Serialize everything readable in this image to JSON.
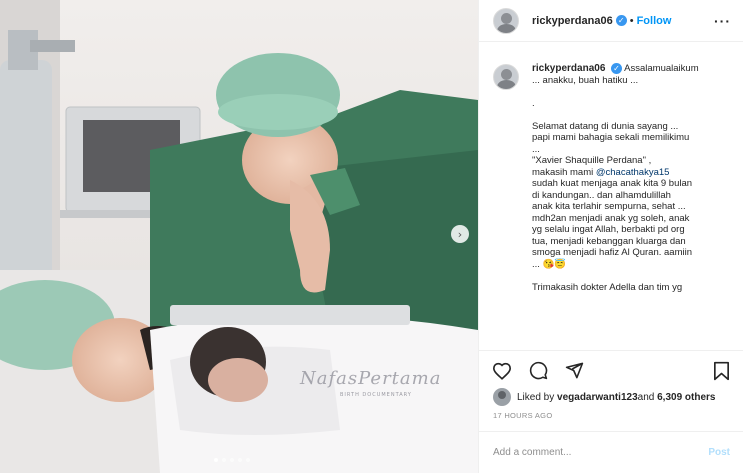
{
  "post": {
    "username": "rickyperdana06",
    "separator": "•",
    "follow_label": "Follow",
    "more_icon": "more-options-icon",
    "more_label": "···"
  },
  "media": {
    "next_icon": "chevron-right-icon",
    "next_label": "›",
    "watermark": "NafasPertama",
    "watermark_sub": "BIRTH DOCUMENTARY",
    "carousel_total": 5,
    "carousel_active": 1
  },
  "caption": {
    "username": "rickyperdana06",
    "text_before_mention": "Assalamualaikum\n... anakku, buah hatiku ...\n\n.\n\nSelamat datang di dunia sayang ...\npapi mami bahagia sekali memilikimu\n...\n\"Xavier Shaquille Perdana\" ,\nmakasih mami ",
    "mention": "@chacathakya15",
    "text_after_mention": "\nsudah kuat menjaga anak kita 9 bulan\ndi kandungan.. dan alhamdulillah\nanak kita terlahir sempurna, sehat ...\nmdh2an menjadi anak yg soleh, anak\nyg selalu ingat Allah, berbakti pd org\ntua, menjadi kebanggan kluarga dan\nsmoga menjadi hafiz Al Quran. aamiin\n... 😘😇\n\nTrimakasih dokter Adella dan tim yg"
  },
  "actions": {
    "like_icon": "heart-icon",
    "comment_icon": "comment-icon",
    "share_icon": "share-icon",
    "save_icon": "bookmark-icon"
  },
  "likes": {
    "prefix": "Liked by ",
    "user": "vegadarwanti123",
    "connector": " and ",
    "count": "6,309 others"
  },
  "timestamp": "17 HOURS AGO",
  "comment": {
    "placeholder": "Add a comment...",
    "post_label": "Post"
  },
  "colors": {
    "accent": "#0095f6",
    "verified": "#3897f0",
    "post_disabled": "#b2dffc"
  }
}
